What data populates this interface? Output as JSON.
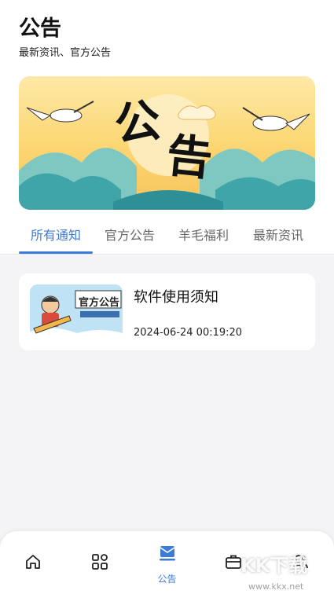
{
  "header": {
    "title": "公告",
    "subtitle": "最新资讯、官方公告"
  },
  "banner": {
    "text_1": "公",
    "text_2": "告"
  },
  "tabs": [
    {
      "label": "所有通知",
      "active": true
    },
    {
      "label": "官方公告",
      "active": false
    },
    {
      "label": "羊毛福利",
      "active": false
    },
    {
      "label": "最新资讯",
      "active": false
    }
  ],
  "notices": [
    {
      "title": "软件使用须知",
      "time": "2024-06-24 00:19:20",
      "thumbnail_text": "官方公告"
    }
  ],
  "bottom_nav": [
    {
      "icon": "home-icon",
      "label": "",
      "active": false
    },
    {
      "icon": "apps-grid-icon",
      "label": "",
      "active": false
    },
    {
      "icon": "announcement-icon",
      "label": "公告",
      "active": true
    },
    {
      "icon": "toolbox-icon",
      "label": "",
      "active": false
    },
    {
      "icon": "user-group-icon",
      "label": "",
      "active": false
    }
  ],
  "watermark": {
    "brand": "KK下载",
    "url": "www.kkx.net"
  },
  "colors": {
    "accent": "#3d7bd9",
    "banner_gold": "#fcd774",
    "background": "#f4f4f6"
  }
}
